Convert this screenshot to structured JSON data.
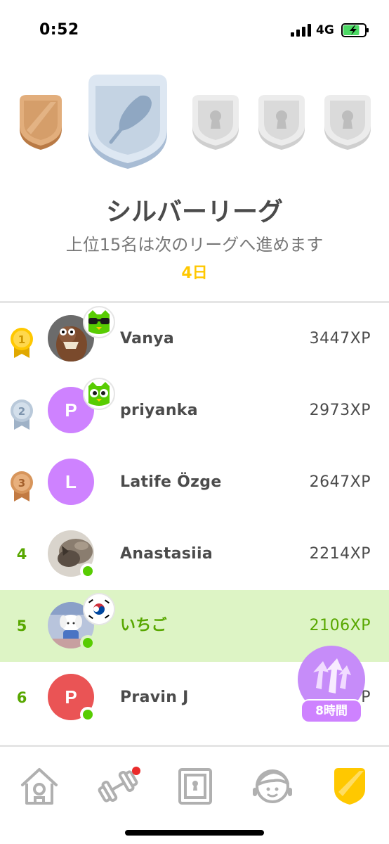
{
  "status_bar": {
    "time": "0:52",
    "network": "4G",
    "battery_level": 0.75
  },
  "league": {
    "title": "シルバーリーグ",
    "subtitle": "上位15名は次のリーグへ進めます",
    "days_left": "4日",
    "badges": [
      {
        "name": "bronze-league",
        "state": "passed",
        "color": "#d59e6a"
      },
      {
        "name": "silver-league",
        "state": "current",
        "color": "#c9d7e6"
      },
      {
        "name": "locked-league",
        "state": "locked",
        "color": "#e5e5e5"
      },
      {
        "name": "locked-league",
        "state": "locked",
        "color": "#e5e5e5"
      },
      {
        "name": "locked-league",
        "state": "locked",
        "color": "#e5e5e5"
      }
    ]
  },
  "leaderboard": [
    {
      "rank": "1",
      "medal": "gold-medal-icon",
      "name": "Vanya",
      "xp": "3447XP",
      "avatar_type": "photo",
      "avatar_color": "#8b5a3c",
      "badge": "sunglasses-owl-icon",
      "online": false,
      "is_me": false
    },
    {
      "rank": "2",
      "medal": "silver-medal-icon",
      "name": "priyanka",
      "xp": "2973XP",
      "avatar_type": "letter",
      "avatar_letter": "P",
      "avatar_color": "#ce82ff",
      "badge": "owl-icon",
      "online": false,
      "is_me": false
    },
    {
      "rank": "3",
      "medal": "bronze-medal-icon",
      "name": "Latife Özge",
      "xp": "2647XP",
      "avatar_type": "letter",
      "avatar_letter": "L",
      "avatar_color": "#ce82ff",
      "badge": null,
      "online": false,
      "is_me": false
    },
    {
      "rank": "4",
      "medal": null,
      "name": "Anastasiia",
      "xp": "2214XP",
      "avatar_type": "photo",
      "avatar_color": "#8a7d6f",
      "badge": null,
      "online": true,
      "is_me": false
    },
    {
      "rank": "5",
      "medal": null,
      "name": "いちご",
      "xp": "2106XP",
      "avatar_type": "photo",
      "avatar_color": "#9aa8c8",
      "badge": "korea-flag-icon",
      "online": true,
      "is_me": true
    },
    {
      "rank": "6",
      "medal": null,
      "name": "Pravin J",
      "xp": "P",
      "avatar_type": "letter",
      "avatar_letter": "P",
      "avatar_color": "#ea5455",
      "badge": null,
      "online": true,
      "is_me": false
    }
  ],
  "boost": {
    "label": "8時間",
    "icon": "xp-boost-arrows-icon",
    "color": "#ce82ff"
  },
  "bottom_nav": [
    {
      "name": "home-icon",
      "active": false,
      "notification": false
    },
    {
      "name": "dumbbell-icon",
      "active": false,
      "notification": true
    },
    {
      "name": "chest-icon",
      "active": false,
      "notification": false
    },
    {
      "name": "profile-icon",
      "active": false,
      "notification": false
    },
    {
      "name": "league-shield-icon",
      "active": true,
      "notification": false
    }
  ],
  "colors": {
    "accent_green": "#58a700",
    "highlight_row": "#ddf4c5",
    "gold": "#ffc800",
    "online": "#58cc02"
  }
}
